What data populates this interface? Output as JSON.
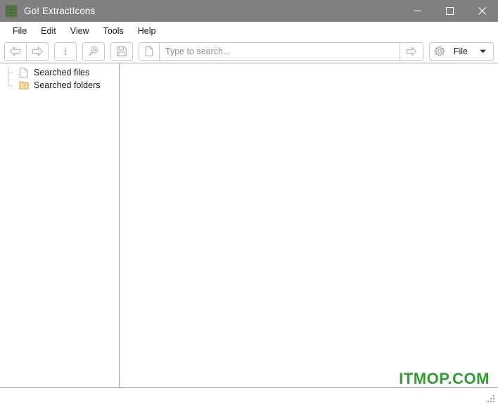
{
  "window": {
    "title": "Go! ExtractIcons",
    "icon": "app-knot-icon",
    "title_bar_color": "#808080",
    "controls": {
      "minimize": "minimize-icon",
      "maximize": "maximize-icon",
      "close": "close-icon"
    }
  },
  "menu": {
    "items": [
      {
        "label": "File"
      },
      {
        "label": "Edit"
      },
      {
        "label": "View"
      },
      {
        "label": "Tools"
      },
      {
        "label": "Help"
      }
    ]
  },
  "toolbar": {
    "nav": [
      {
        "name": "back-button",
        "icon": "arrow-left-icon"
      },
      {
        "name": "forward-button",
        "icon": "arrow-right-icon"
      }
    ],
    "info_button": {
      "name": "info-button",
      "icon": "info-icon"
    },
    "find_button": {
      "name": "find-button",
      "icon": "magnifier-key-icon"
    },
    "save_button": {
      "name": "save-button",
      "icon": "floppy-disk-icon"
    },
    "search": {
      "type_icon": "document-icon",
      "placeholder": "Type to search...",
      "value": "",
      "go_icon": "arrow-right-circle-icon"
    },
    "file_dropdown": {
      "icon": "gear-icon",
      "label": "File",
      "caret": "chevron-down-icon"
    }
  },
  "tree": {
    "items": [
      {
        "label": "Searched files",
        "icon": "document-icon"
      },
      {
        "label": "Searched folders",
        "icon": "folder-icon"
      }
    ]
  },
  "content": {
    "empty": ""
  },
  "watermark": {
    "text": "ITMOP.COM",
    "color": "#2ca02c"
  },
  "status_bar": {
    "text": "",
    "grip": "resize-grip-icon"
  }
}
